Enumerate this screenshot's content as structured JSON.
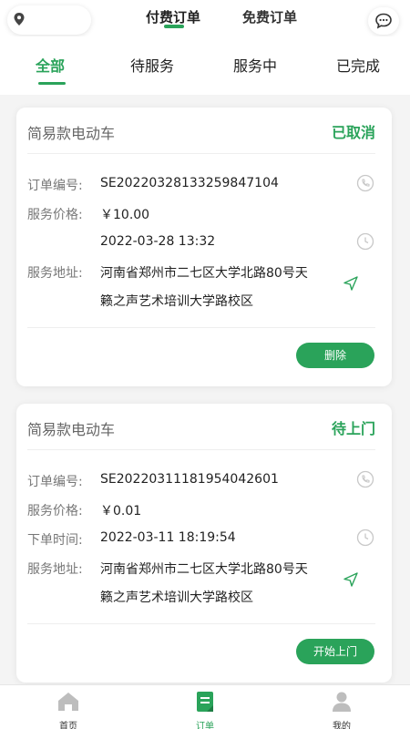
{
  "header": {
    "tabs": [
      {
        "label": "付费订单",
        "active": true
      },
      {
        "label": "免费订单",
        "active": false
      }
    ]
  },
  "status_tabs": [
    {
      "label": "全部",
      "active": true
    },
    {
      "label": "待服务",
      "active": false
    },
    {
      "label": "服务中",
      "active": false
    },
    {
      "label": "已完成",
      "active": false
    }
  ],
  "orders": [
    {
      "title": "简易款电动车",
      "status": "已取消",
      "order_no_label": "订单编号:",
      "order_no": "SE20220328133259847104",
      "price_label": "服务价格:",
      "price": "￥10.00",
      "time_label": "",
      "time": "2022-03-28 13:32",
      "address_label": "服务地址:",
      "address_line1": "河南省郑州市二七区大学北路80号天",
      "address_line2": "籁之声艺术培训大学路校区",
      "action": "删除"
    },
    {
      "title": "简易款电动车",
      "status": "待上门",
      "order_no_label": "订单编号:",
      "order_no": "SE20220311181954042601",
      "price_label": "服务价格:",
      "price": "￥0.01",
      "time_label": "下单时间:",
      "time": "2022-03-11 18:19:54",
      "address_label": "服务地址:",
      "address_line1": "河南省郑州市二七区大学北路80号天",
      "address_line2": "籁之声艺术培训大学路校区",
      "action": "开始上门"
    }
  ],
  "bottom_nav": [
    {
      "label": "首页",
      "icon": "home-icon",
      "active": false
    },
    {
      "label": "订单",
      "icon": "order-icon",
      "active": true
    },
    {
      "label": "我的",
      "icon": "profile-icon",
      "active": false
    }
  ],
  "colors": {
    "accent": "#2aa35a",
    "background": "#f4f4f4",
    "card": "#ffffff",
    "icon_gray": "#c8c8c8"
  }
}
